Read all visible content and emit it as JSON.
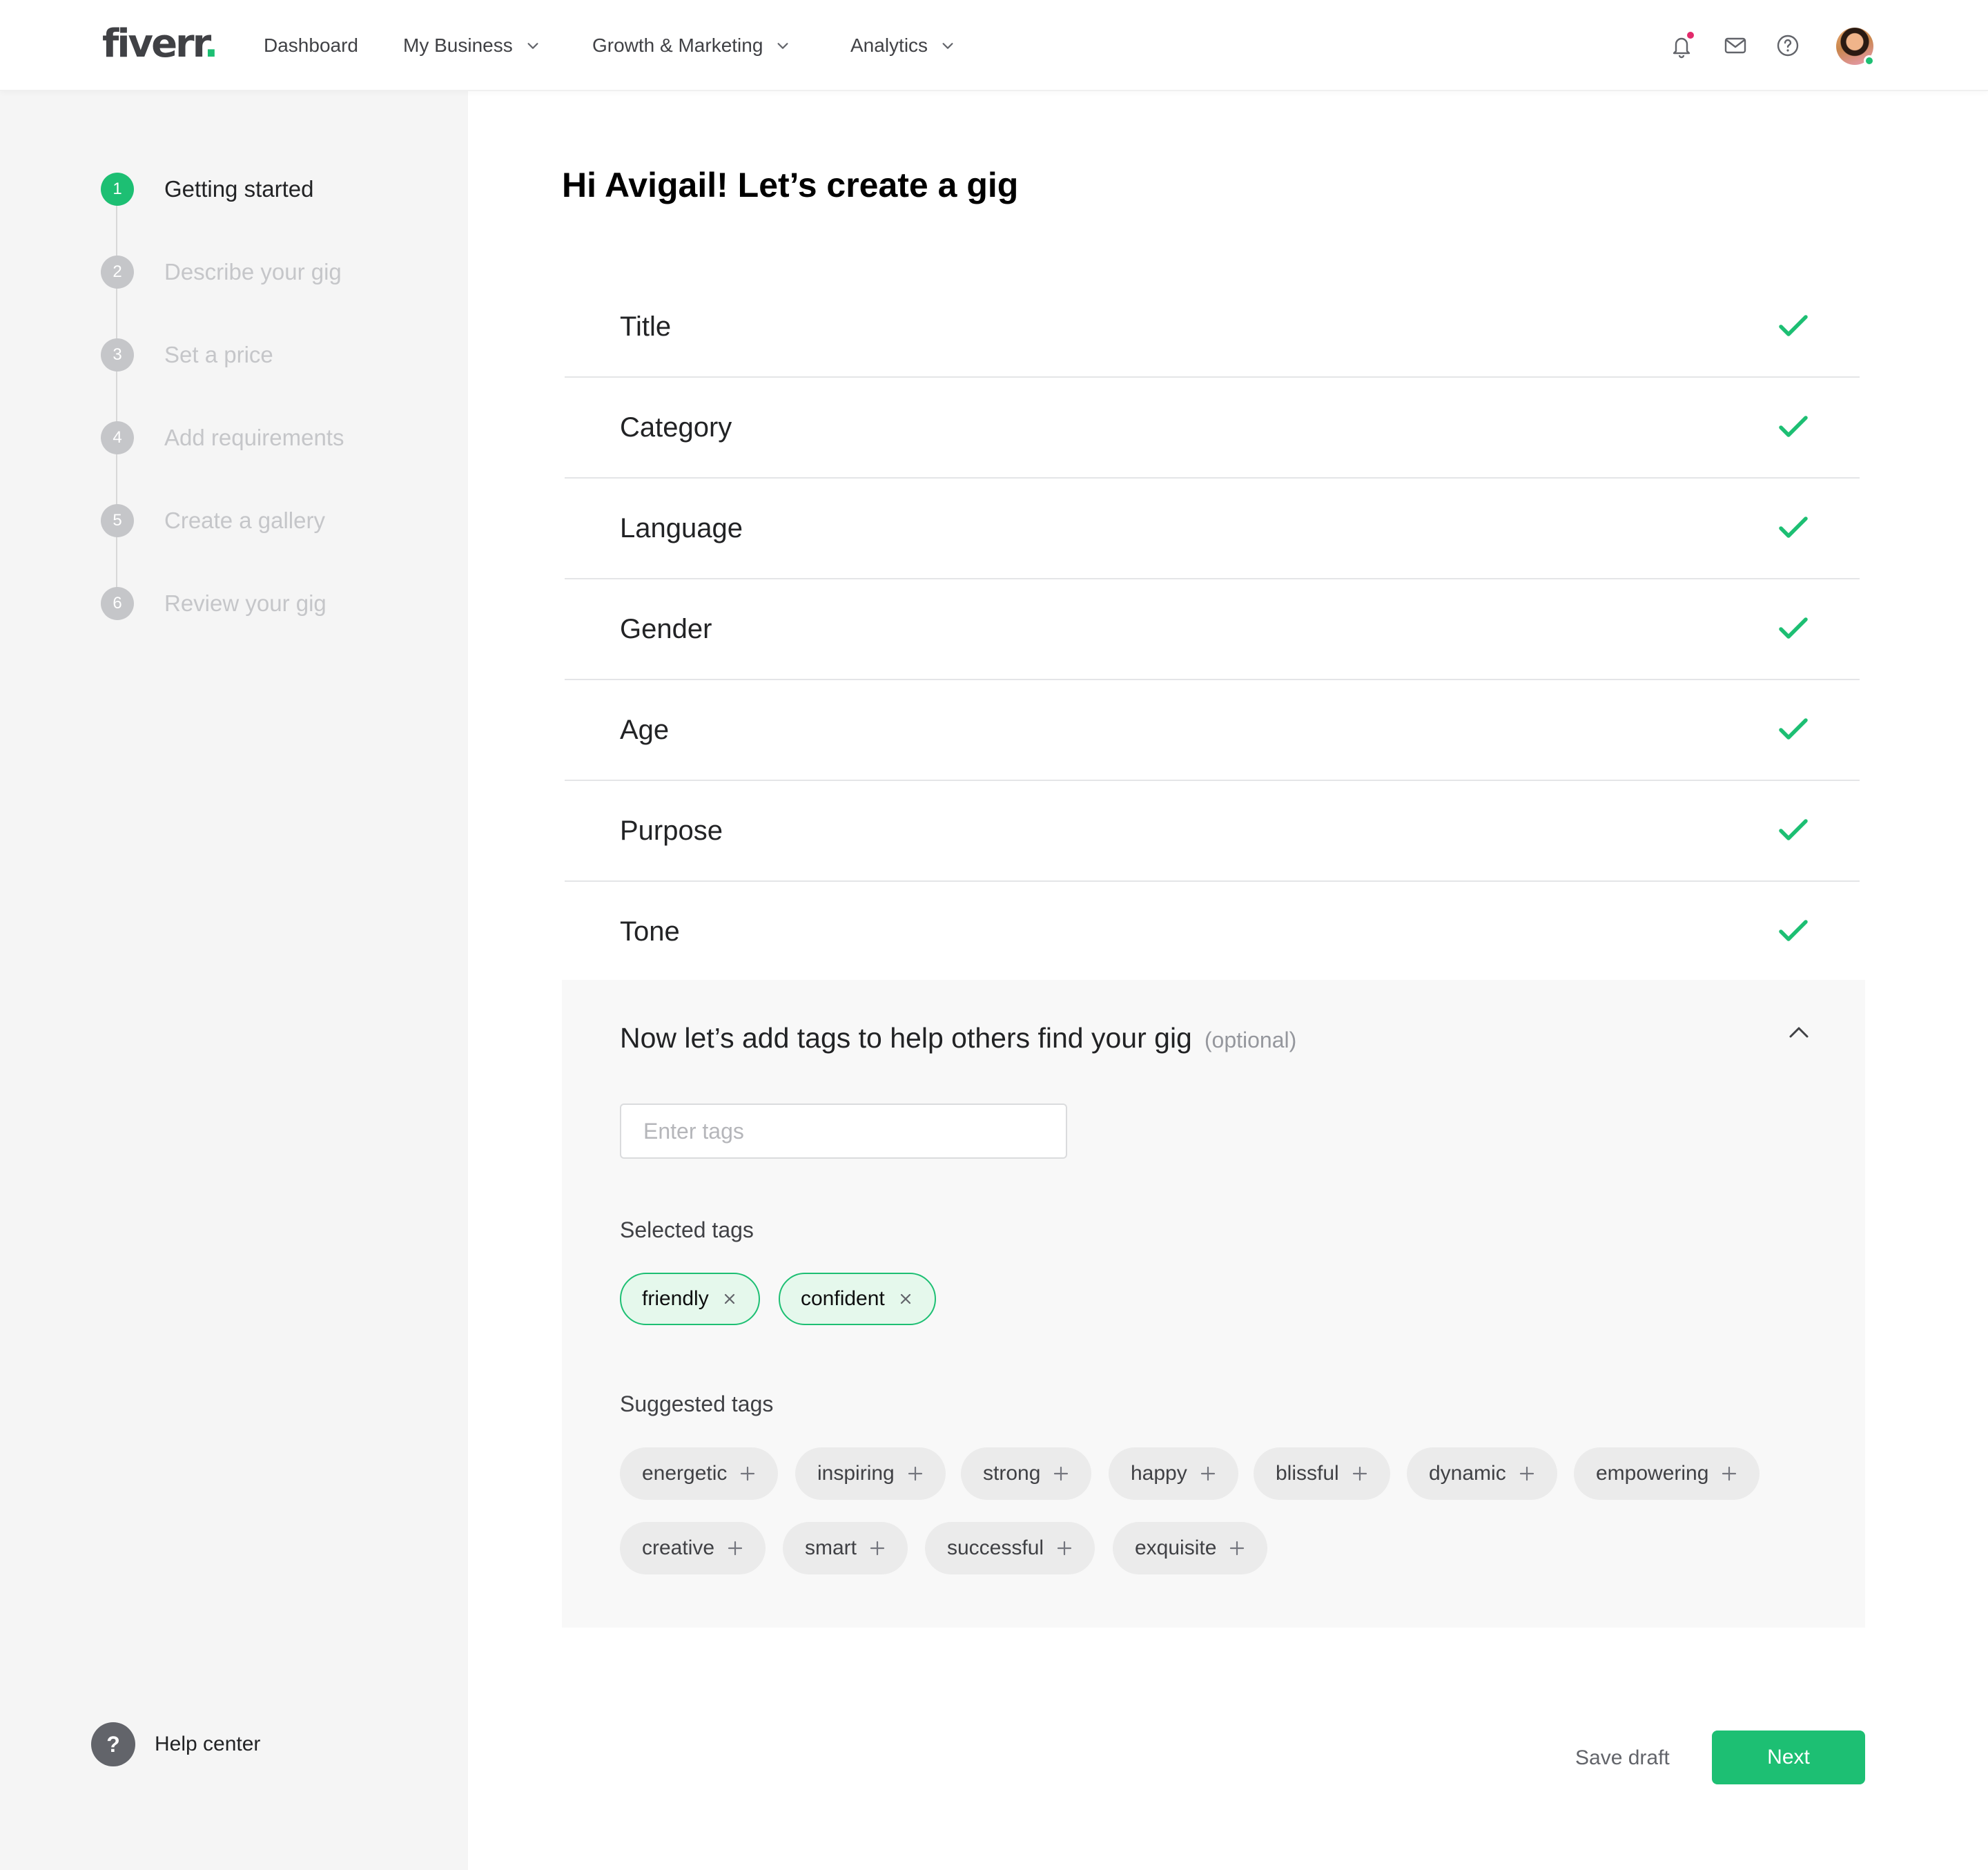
{
  "brand": {
    "logo_text": "fiverr",
    "logo_dot": ".",
    "accent_color": "#1dbf73",
    "muted_color": "#c5c6c9"
  },
  "nav": {
    "items": [
      {
        "label": "Dashboard",
        "has_dropdown": false
      },
      {
        "label": "My Business",
        "has_dropdown": true
      },
      {
        "label": "Growth & Marketing",
        "has_dropdown": true
      },
      {
        "label": "Analytics",
        "has_dropdown": true
      }
    ],
    "icons": [
      "bell-icon",
      "envelope-icon",
      "question-circle-icon"
    ],
    "notification_badge_color": "#e22a6b"
  },
  "sidebar": {
    "steps": [
      {
        "number": "1",
        "label": "Getting started",
        "active": true
      },
      {
        "number": "2",
        "label": "Describe your gig",
        "active": false
      },
      {
        "number": "3",
        "label": "Set a price",
        "active": false
      },
      {
        "number": "4",
        "label": "Add requirements",
        "active": false
      },
      {
        "number": "5",
        "label": "Create a gallery",
        "active": false
      },
      {
        "number": "6",
        "label": "Review your gig",
        "active": false
      }
    ],
    "help": {
      "icon_glyph": "?",
      "label": "Help center"
    }
  },
  "main": {
    "title": "Hi Avigail! Let’s create a gig",
    "checklist": [
      {
        "label": "Title",
        "completed": true
      },
      {
        "label": "Category",
        "completed": true
      },
      {
        "label": "Language",
        "completed": true
      },
      {
        "label": "Gender",
        "completed": true
      },
      {
        "label": "Age",
        "completed": true
      },
      {
        "label": "Purpose",
        "completed": true
      },
      {
        "label": "Tone",
        "completed": true
      }
    ],
    "tags": {
      "heading": "Now let’s add tags to help others find your gig",
      "optional": "(optional)",
      "input_placeholder": "Enter tags",
      "input_value": "",
      "selected_label": "Selected tags",
      "selected": [
        "friendly",
        "confident"
      ],
      "suggested_label": "Suggested tags",
      "suggested": [
        "energetic",
        "inspiring",
        "strong",
        "happy",
        "blissful",
        "dynamic",
        "empowering",
        "creative",
        "smart",
        "successful",
        "exquisite"
      ]
    }
  },
  "footer": {
    "save_draft": "Save draft",
    "next": "Next"
  }
}
